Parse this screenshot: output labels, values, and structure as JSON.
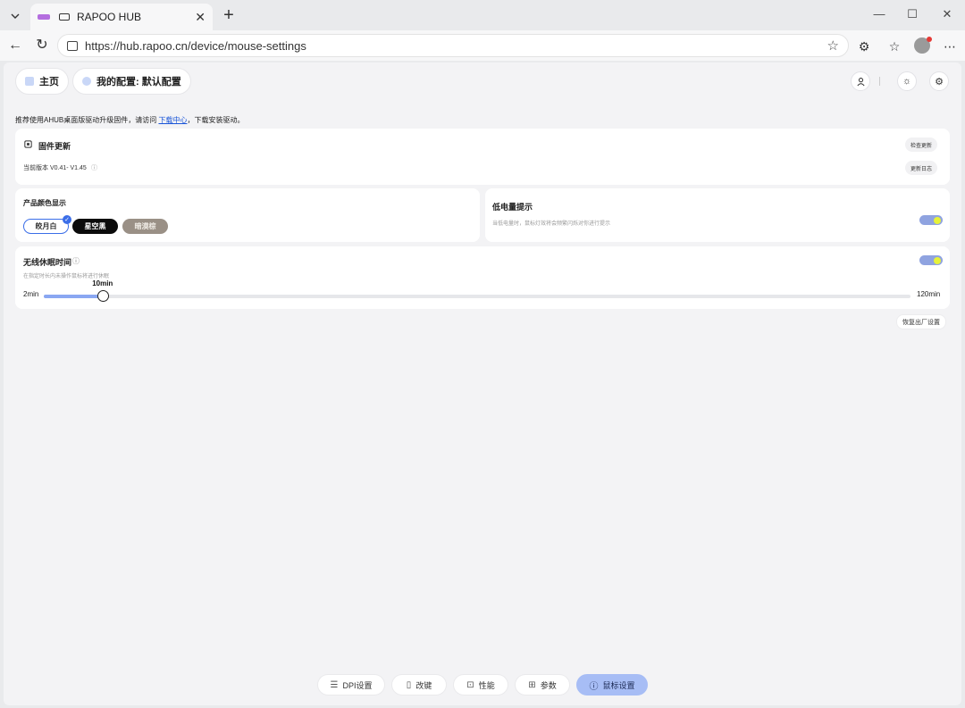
{
  "browser": {
    "tab_title": "RAPOO HUB",
    "url": "https://hub.rapoo.cn/device/mouse-settings"
  },
  "header": {
    "home_label": "主页",
    "profile_label": "我的配置: 默认配置"
  },
  "notice": {
    "text_before": "推荐使用AHUB桌面版驱动升级固件，请访问 ",
    "link": "下载中心",
    "text_after": "，下载安装驱动。"
  },
  "firmware": {
    "title": "固件更新",
    "version": "当前版本 V0.41- V1.45",
    "check_update": "检查更新",
    "changelog": "更新日志"
  },
  "color_display": {
    "title": "产品颜色显示",
    "options": [
      "皎月白",
      "星空黑",
      "暗漠棕"
    ],
    "selected": "皎月白"
  },
  "low_battery": {
    "title": "低电量提示",
    "description": "当低电量时，鼠标灯效将会频繁闪烁对你进行提示",
    "enabled": true
  },
  "sleep": {
    "title": "无线休眠时间",
    "description": "在指定时长内未操作鼠标将进行休眠",
    "min_label": "2min",
    "max_label": "120min",
    "value_label": "10min",
    "value": 10,
    "min": 2,
    "max": 120,
    "enabled": true
  },
  "reset_label": "恢复出厂设置",
  "bottom_nav": [
    {
      "label": "DPI设置",
      "icon": "sliders-icon"
    },
    {
      "label": "改键",
      "icon": "mouse-icon"
    },
    {
      "label": "性能",
      "icon": "performance-icon"
    },
    {
      "label": "参数",
      "icon": "grid-icon"
    },
    {
      "label": "鼠标设置",
      "icon": "info-icon",
      "active": true
    }
  ],
  "colors": {
    "accent": "#3b6ee8",
    "toggle_track": "#8fa3e0",
    "toggle_knob": "#e6f23a",
    "active_nav": "#a7bdf5"
  }
}
